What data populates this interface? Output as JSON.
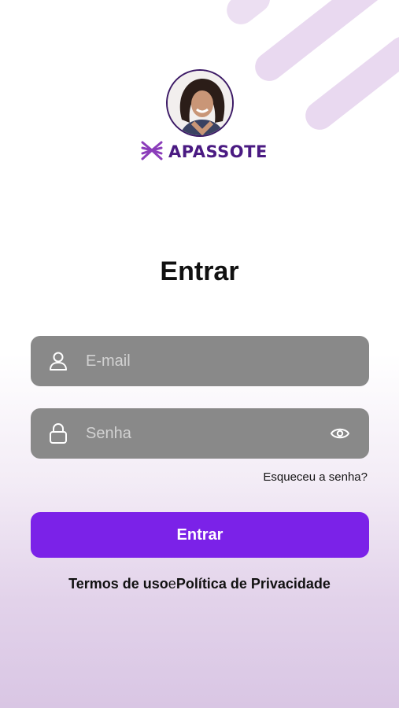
{
  "brand": {
    "name": "APASSOTE"
  },
  "login": {
    "title": "Entrar",
    "email_placeholder": "E-mail",
    "password_placeholder": "Senha",
    "forgot_password": "Esqueceu a senha?",
    "submit_label": "Entrar"
  },
  "legal": {
    "terms": "Termos de uso",
    "conjunction": "e",
    "privacy": "Política de Privacidade"
  },
  "colors": {
    "primary_button": "#7b22e8",
    "brand_purple": "#4a1a82",
    "input_background": "#898989"
  },
  "icons": {
    "email_field": "user-icon",
    "password_field": "lock-icon",
    "password_toggle": "eye-icon",
    "brand_logo": "apassote-logo-icon"
  }
}
